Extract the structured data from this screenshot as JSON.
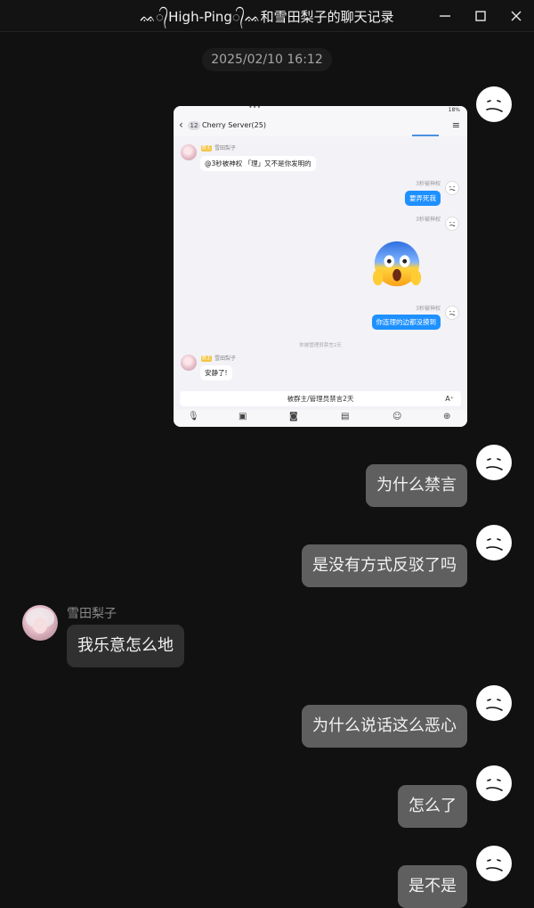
{
  "window": {
    "title": "ᨐ᭄High-Ping᭄ᨐ和雪田梨子的聊天记录",
    "minimize_icon": "minimize-icon",
    "maximize_icon": "maximize-icon",
    "close_icon": "close-icon"
  },
  "timestamp": "2025/02/10 16:12",
  "contact": {
    "name": "雪田梨子"
  },
  "image_message": {
    "header_count": "12",
    "header_title": "Cherry Server(25)",
    "battery": "18%",
    "msg1_badge": "群主",
    "msg1_sender": "雪田梨子",
    "msg1_text": "@3秒被神权 「理」又不是你发明的",
    "msg2_sender": "3秒被神权",
    "msg2_text": "要弄死我",
    "msg3_sender": "3秒被神权",
    "msg4_sender": "3秒被神权",
    "msg4_text": "你连理的边都没摸到",
    "system_text": "你被管理员禁言2天",
    "msg5_badge": "群主",
    "msg5_sender": "雪田梨子",
    "msg5_text": "安静了!",
    "input_text": "被群主/管理员禁言2天"
  },
  "messages": [
    {
      "from": "me",
      "text": "为什么禁言"
    },
    {
      "from": "me",
      "text": "是没有方式反驳了吗"
    },
    {
      "from": "contact",
      "text": "我乐意怎么地"
    },
    {
      "from": "me",
      "text": "为什么说话这么恶心"
    },
    {
      "from": "me",
      "text": "怎么了"
    },
    {
      "from": "me",
      "text": "是不是"
    }
  ],
  "colors": {
    "background": "#111111",
    "my_bubble": "#5f5f5f",
    "their_bubble": "#303030",
    "mini_blue_bubble": "#1e90ff"
  }
}
